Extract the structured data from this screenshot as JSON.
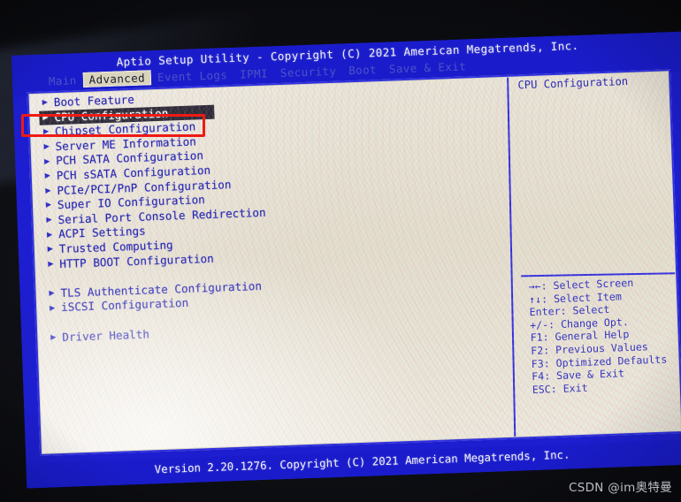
{
  "header": {
    "title": "Aptio Setup Utility - Copyright (C) 2021 American Megatrends, Inc.",
    "tabs": [
      {
        "label": "Main",
        "active": false
      },
      {
        "label": "Advanced",
        "active": true
      },
      {
        "label": "Event Logs",
        "active": false
      },
      {
        "label": "IPMI",
        "active": false
      },
      {
        "label": "Security",
        "active": false
      },
      {
        "label": "Boot",
        "active": false
      },
      {
        "label": "Save & Exit",
        "active": false
      }
    ]
  },
  "menu": {
    "bullet": "▶",
    "items": [
      {
        "label": "Boot Feature",
        "selected": false,
        "gap_before": false
      },
      {
        "label": "CPU Configuration",
        "selected": true,
        "gap_before": false
      },
      {
        "label": "Chipset Configuration",
        "selected": false,
        "gap_before": false
      },
      {
        "label": "Server ME Information",
        "selected": false,
        "gap_before": false
      },
      {
        "label": "PCH SATA Configuration",
        "selected": false,
        "gap_before": false
      },
      {
        "label": "PCH sSATA Configuration",
        "selected": false,
        "gap_before": false
      },
      {
        "label": "PCIe/PCI/PnP Configuration",
        "selected": false,
        "gap_before": false
      },
      {
        "label": "Super IO Configuration",
        "selected": false,
        "gap_before": false
      },
      {
        "label": "Serial Port Console Redirection",
        "selected": false,
        "gap_before": false
      },
      {
        "label": "ACPI Settings",
        "selected": false,
        "gap_before": false
      },
      {
        "label": "Trusted Computing",
        "selected": false,
        "gap_before": false
      },
      {
        "label": "HTTP BOOT Configuration",
        "selected": false,
        "gap_before": false
      },
      {
        "label": "TLS Authenticate Configuration",
        "selected": false,
        "gap_before": true
      },
      {
        "label": "iSCSI Configuration",
        "selected": false,
        "gap_before": false
      },
      {
        "label": "Driver Health",
        "selected": false,
        "gap_before": true
      }
    ]
  },
  "help": {
    "title": "CPU Configuration",
    "keys": [
      "→←: Select Screen",
      "↑↓: Select Item",
      "Enter: Select",
      "+/-: Change Opt.",
      "F1: General Help",
      "F2: Previous Values",
      "F3: Optimized Defaults",
      "F4: Save & Exit",
      "ESC: Exit"
    ]
  },
  "footer": {
    "version": "Version 2.20.1276. Copyright (C) 2021 American Megatrends, Inc."
  },
  "watermark": {
    "text": "CSDN @im奥特曼"
  },
  "annotation": {
    "target": "CPU Configuration",
    "color": "#ee1b13"
  },
  "colors": {
    "screen_blue": "#1a1ccb",
    "body_beige": "#e2dfce",
    "menu_text": "#1f22b4",
    "selected_bg": "#2a2a38",
    "selected_text": "#ffffff",
    "border_blue": "#2f2fe0",
    "annotation_red": "#ee1b13"
  }
}
